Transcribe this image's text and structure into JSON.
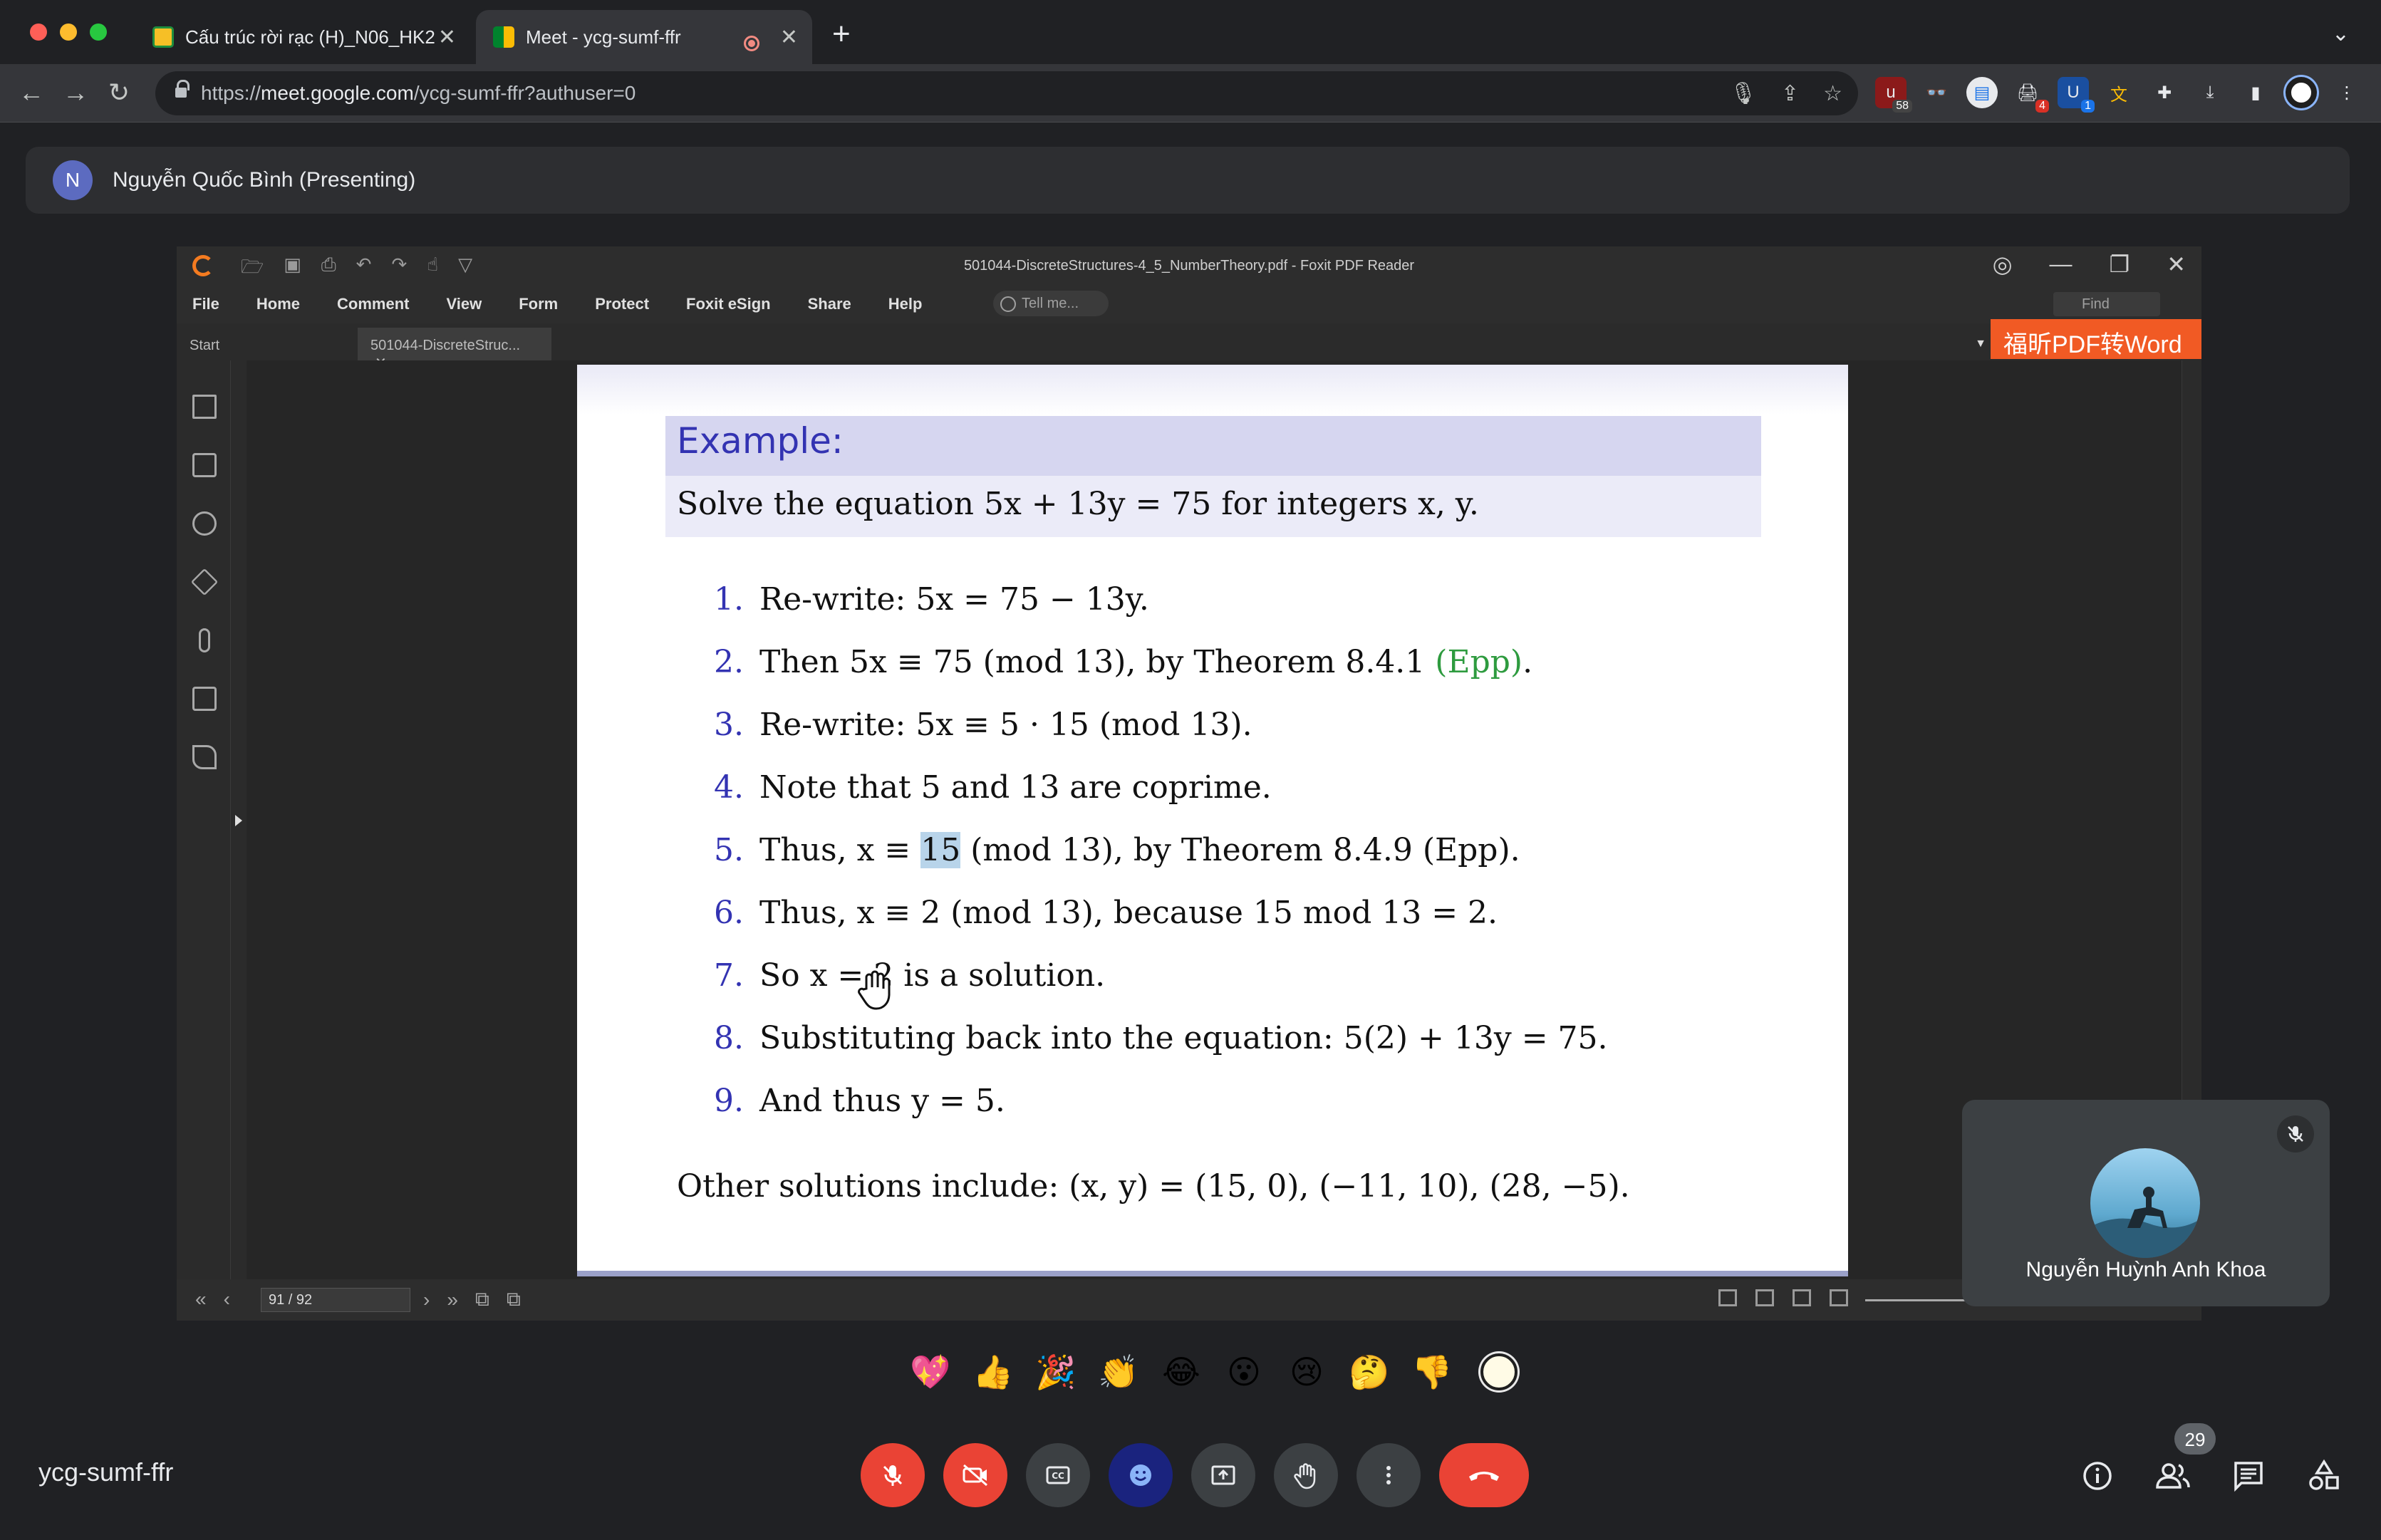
{
  "browser": {
    "tabs": [
      {
        "title": "Cấu trúc rời rạc (H)_N06_HK2"
      },
      {
        "title": "Meet - ycg-sumf-ffr"
      }
    ],
    "url_prefix": "https://",
    "url_host": "meet.google.com",
    "url_path": "/ycg-sumf-ffr?authuser=0",
    "extension_badges": [
      "58",
      "4",
      "1"
    ]
  },
  "meet": {
    "presenter_initial": "N",
    "presenter_label": "Nguyễn Quốc Bình (Presenting)",
    "meeting_code": "ycg-sumf-ffr",
    "participant_name": "Nguyễn Huỳnh Anh Khoa",
    "participants_count": "29",
    "reactions": [
      "💖",
      "👍",
      "🎉",
      "👏",
      "😂",
      "😮",
      "😢",
      "🤔",
      "👎"
    ],
    "colors": {
      "end_call": "#ea4335",
      "mic_off": "#ea4335",
      "emoji_active": "#1a237e"
    }
  },
  "foxit": {
    "window_title": "501044-DiscreteStructures-4_5_NumberTheory.pdf - Foxit PDF Reader",
    "menu": [
      "File",
      "Home",
      "Comment",
      "View",
      "Form",
      "Protect",
      "Foxit eSign",
      "Share",
      "Help"
    ],
    "tell_me": "Tell me...",
    "find": "Find",
    "tab_start": "Start",
    "tab_doc": "501044-DiscreteStruc...",
    "convert_button": "福昕PDF转Word",
    "page_indicator": "91 / 92"
  },
  "slide": {
    "example_title": "Example:",
    "problem": "Solve the equation 5x + 13y = 75 for integers x, y.",
    "steps": [
      {
        "num": "1.",
        "text": "Re-write:  5x = 75 − 13y."
      },
      {
        "num": "2.",
        "pre": "Then 5x ≡ 75  (mod 13), by Theorem 8.4.1 ",
        "epp": "(Epp)",
        "post": "."
      },
      {
        "num": "3.",
        "text": "Re-write:  5x ≡ 5 · 15  (mod 13)."
      },
      {
        "num": "4.",
        "text": "Note that 5 and 13 are coprime."
      },
      {
        "num": "5.",
        "pre": "Thus,  x ≡ ",
        "hl": "15",
        "post": "  (mod 13), by Theorem 8.4.9 (Epp)."
      },
      {
        "num": "6.",
        "text": "Thus,  x ≡ 2  (mod 13), because 15 mod 13 = 2."
      },
      {
        "num": "7.",
        "text": "So  x = 2  is a solution."
      },
      {
        "num": "8.",
        "text": "Substituting back into the equation:  5(2) + 13y = 75."
      },
      {
        "num": "9.",
        "text": "And thus  y = 5."
      }
    ],
    "other": "Other solutions include:  (x, y) = (15, 0), (−11, 10), (28, −5)."
  }
}
